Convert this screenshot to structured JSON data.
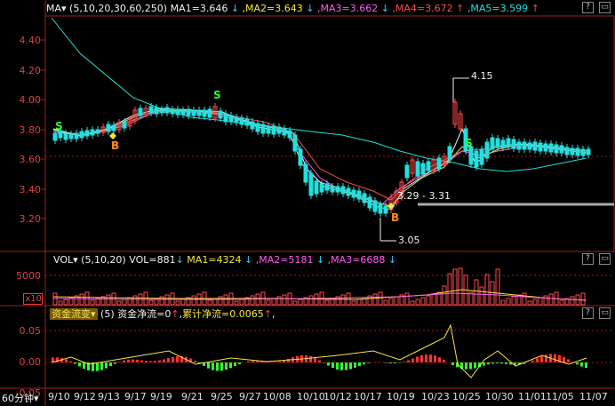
{
  "main_panel": {
    "indicator": "MA",
    "params": "(5,10,20,30,60,250)",
    "ma_values": [
      {
        "label": "MA1=3.646",
        "arrow": "↓",
        "color": "#f0f0f0"
      },
      {
        "label": "MA2=3.643",
        "arrow": "↓",
        "color": "#f5e642"
      },
      {
        "label": "MA3=3.662",
        "arrow": "↓",
        "color": "#ff5cf0"
      },
      {
        "label": "MA4=3.672",
        "arrow": "↑",
        "color": "#ff4a4a"
      },
      {
        "label": "MA5=3.599",
        "arrow": "↑",
        "color": "#22e0e0"
      }
    ],
    "y_ticks": [
      "4.40",
      "4.20",
      "4.00",
      "3.80",
      "3.60",
      "3.40",
      "3.20"
    ],
    "annotations": {
      "high": "4.15",
      "low": "3.05",
      "range": "3.29 - 3.31"
    },
    "signals": [
      "S",
      "B",
      "S",
      "B",
      "S"
    ]
  },
  "volume_panel": {
    "indicator": "VOL",
    "params": "(5,10,20)",
    "vol": "VOL=881",
    "ma_values": [
      {
        "label": "MA1=4324",
        "arrow": "↓",
        "color": "#f5e642"
      },
      {
        "label": "MA2=5181",
        "arrow": "↓",
        "color": "#ff5cf0"
      },
      {
        "label": "MA3=6688",
        "arrow": "↓",
        "color": "#ff5cf0"
      }
    ],
    "y_ticks": [
      "5000",
      "x10"
    ]
  },
  "flow_panel": {
    "indicator": "资金流变",
    "params": "(5)",
    "net": "资金净流=0",
    "cumulative": "累计净流=0.0065",
    "y_ticks": [
      "0.05",
      "0.00",
      "-0.05"
    ]
  },
  "period": "60分钟",
  "dates": [
    "9/10",
    "9/12",
    "9/13",
    "9/17",
    "9/19",
    "9/21",
    "9/25",
    "9/27",
    "10/08",
    "10/10",
    "10/12",
    "10/17",
    "10/19",
    "10/23",
    "10/25",
    "10/30",
    "11/01",
    "11/05",
    "11/07"
  ],
  "controls": {
    "help": "?",
    "expand": "▭",
    "sub_help": "?",
    "sub_expand": "▭"
  }
}
